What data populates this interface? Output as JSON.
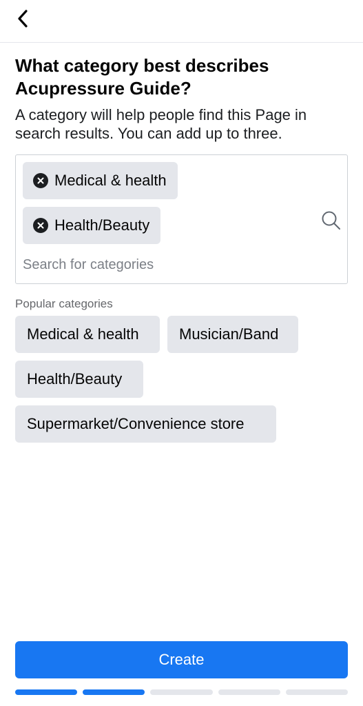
{
  "header": {
    "back_icon": "chevron-left-icon"
  },
  "title": "What category best describes Acupressure Guide?",
  "subtitle": "A category will help people find this Page in search results. You can add up to three.",
  "search": {
    "selected": [
      "Medical & health",
      "Health/Beauty"
    ],
    "placeholder": "Search for categories",
    "value": "",
    "remove_icon": "close-circle-icon",
    "search_icon": "search-icon"
  },
  "popular": {
    "label": "Popular categories",
    "items": [
      "Medical & health",
      "Musician/Band",
      "Health/Beauty",
      "Supermarket/Convenience store"
    ]
  },
  "create_label": "Create",
  "progress": {
    "total_steps": 5,
    "completed_steps": 2
  },
  "colors": {
    "accent": "#1877f2",
    "chip_bg": "#e4e6eb",
    "text": "#050505",
    "muted": "#65676b"
  }
}
